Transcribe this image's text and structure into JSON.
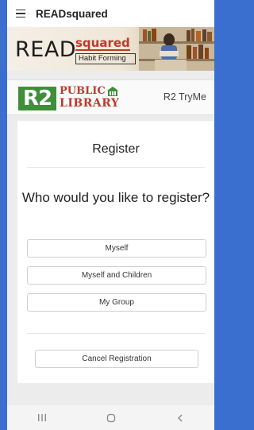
{
  "app": {
    "title": "READsquared"
  },
  "banner": {
    "brand_main": "READ",
    "brand_accent": "squared",
    "tagline": "Habit Forming"
  },
  "library": {
    "logo_mark": "R2",
    "name_line1": "PUBLIC",
    "name_line2": "LIBRARY",
    "program": "R2 TryMe"
  },
  "register": {
    "title": "Register",
    "question": "Who would you like to register?",
    "options": [
      "Myself",
      "Myself and Children",
      "My Group"
    ],
    "cancel_label": "Cancel Registration"
  },
  "icons": {
    "menu": "hamburger-icon",
    "recents": "recents-icon",
    "home": "home-icon",
    "back": "back-icon"
  },
  "colors": {
    "frame": "#3a6fd0",
    "library_green": "#3f8f3a",
    "library_red": "#c0392b"
  }
}
